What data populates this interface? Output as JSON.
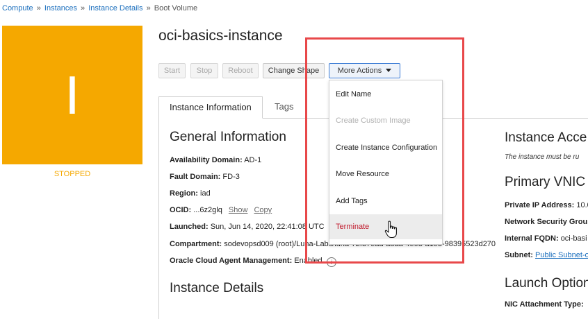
{
  "breadcrumb": {
    "items": [
      "Compute",
      "Instances",
      "Instance Details"
    ],
    "current": "Boot Volume",
    "separator": "»"
  },
  "instance": {
    "icon_letter": "I",
    "state": "STOPPED",
    "name": "oci-basics-instance",
    "state_color": "#f5a800"
  },
  "actions": {
    "start": "Start",
    "stop": "Stop",
    "reboot": "Reboot",
    "change_shape": "Change Shape",
    "more_actions": "More Actions"
  },
  "tabs": {
    "instance_information": "Instance Information",
    "tags": "Tags"
  },
  "general": {
    "heading": "General Information",
    "availability_domain_label": "Availability Domain:",
    "availability_domain_value": "AD-1",
    "fault_domain_label": "Fault Domain:",
    "fault_domain_value": "FD-3",
    "region_label": "Region:",
    "region_value": "iad",
    "ocid_label": "OCID:",
    "ocid_value": "...6z2glq",
    "ocid_show": "Show",
    "ocid_copy": "Copy",
    "launched_label": "Launched:",
    "launched_value": "Sun, Jun 14, 2020, 22:41:08 UTC",
    "compartment_label": "Compartment:",
    "compartment_value": "sodevopsd009 (root)/Luna-Labs/luna-72f37ead-a8aa-4e93-a1e3-98395523d270",
    "agent_label": "Oracle Cloud Agent Management:",
    "agent_value": "Enabled",
    "instance_details_heading": "Instance Details"
  },
  "right_column": {
    "instance_access_heading": "Instance Acce",
    "instance_access_note": "The instance must be ru",
    "primary_vnic_heading": "Primary VNIC",
    "private_ip_label": "Private IP Address:",
    "private_ip_value": "10.0",
    "nsg_label": "Network Security Grou",
    "internal_fqdn_label": "Internal FQDN:",
    "internal_fqdn_value": "oci-basi",
    "subnet_label": "Subnet:",
    "subnet_value": "Public Subnet-o",
    "launch_options_heading": "Launch Option",
    "nic_attachment_label": "NIC Attachment Type:"
  },
  "more_actions_menu": {
    "items": [
      "Edit Name",
      "Create Custom Image",
      "Create Instance Configuration",
      "Move Resource",
      "Add Tags",
      "Terminate"
    ]
  },
  "colors": {
    "accent_link": "#1a6ebd",
    "highlight_border": "#e8484a",
    "terminate": "#c0192b"
  }
}
